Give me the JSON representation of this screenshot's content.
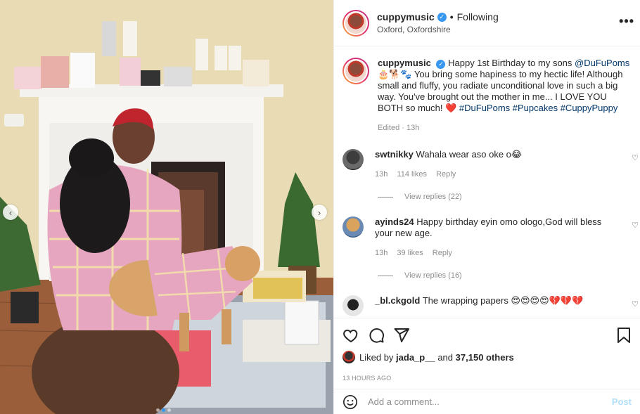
{
  "post": {
    "username": "cuppymusic",
    "follow_status": "Following",
    "location": "Oxford, Oxfordshire",
    "more_icon": "more-options-icon"
  },
  "caption": {
    "username": "cuppymusic",
    "text_a": "Happy 1st Birthday to my sons",
    "mention": "@DuFuPoms",
    "emoji_a": "🎂🐕🐾",
    "text_b": "You bring some hapiness to my hectic life! Although small and fluffy, you radiate unconditional love in such a big way. You've brought out the mother in me... I LOVE YOU BOTH so much!",
    "emoji_b": "❤️",
    "hashtags": "#DuFuPoms #Pupcakes #CuppyPuppy",
    "edited": "Edited · 13h"
  },
  "comments": [
    {
      "username": "swtnikky",
      "text": "Wahala wear aso oke o😂",
      "time": "13h",
      "likes": "114 likes",
      "reply": "Reply",
      "view_replies": "View replies (22)"
    },
    {
      "username": "ayinds24",
      "text": "Happy birthday eyin omo ologo,God will bless your new age.",
      "time": "13h",
      "likes": "39 likes",
      "reply": "Reply",
      "view_replies": "View replies (16)"
    },
    {
      "username": "_bl.ckgold",
      "text": "The wrapping papers 😍😍😍😍💔💔💔"
    }
  ],
  "likes": {
    "label_prefix": "Liked by",
    "user": "jada_p__",
    "label_and": "and",
    "others": "37,150 others",
    "time_ago": "13 HOURS AGO"
  },
  "composer": {
    "placeholder": "Add a comment...",
    "post_label": "Post"
  },
  "carousel": {
    "prev_label": "‹",
    "next_label": "›",
    "active_index": 2,
    "count": 3
  },
  "colors": {
    "accent": "#3897f0",
    "link": "#00376b",
    "muted": "#8e8e8e",
    "post_disabled": "#b2dffc"
  }
}
